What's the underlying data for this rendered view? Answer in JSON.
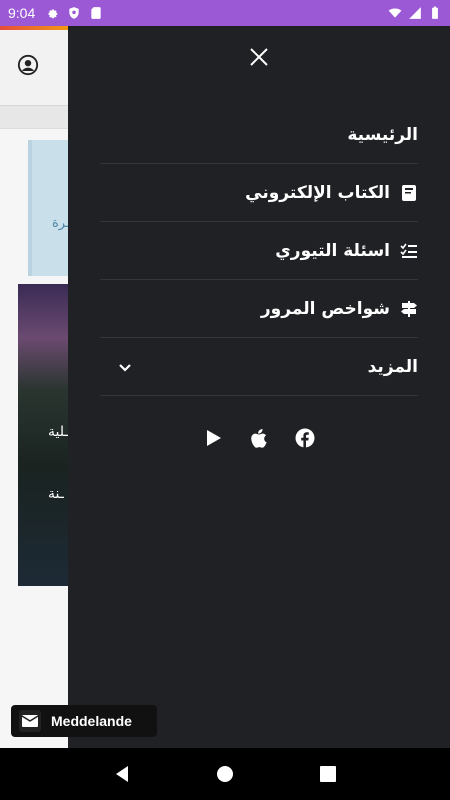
{
  "status_bar": {
    "time": "9:04",
    "icons_left": [
      "gear-icon",
      "shield-icon",
      "sd-card-icon"
    ],
    "icons_right": [
      "wifi-icon",
      "signal-icon",
      "battery-icon"
    ],
    "color": "#9b59d6"
  },
  "background_page": {
    "blue_text": "ـرة",
    "photo_text_1": "ـلية",
    "photo_text_2": "ـنة"
  },
  "drawer": {
    "close_icon": "close-icon",
    "items": [
      {
        "label": "الرئيسية",
        "icon": ""
      },
      {
        "label": "الكتاب الإلكتروني",
        "icon": "book-icon"
      },
      {
        "label": "اسئلة التيوري",
        "icon": "checklist-icon"
      },
      {
        "label": "شواخص المرور",
        "icon": "signpost-icon"
      },
      {
        "label": "المزيد",
        "icon": "chevron-down-icon"
      }
    ],
    "social": [
      "play-store-icon",
      "apple-icon",
      "facebook-icon"
    ]
  },
  "message_chip": {
    "label": "Meddelande",
    "icon": "mail-icon"
  },
  "nav_bar": {
    "buttons": [
      "back-icon",
      "home-icon",
      "recents-icon"
    ]
  }
}
